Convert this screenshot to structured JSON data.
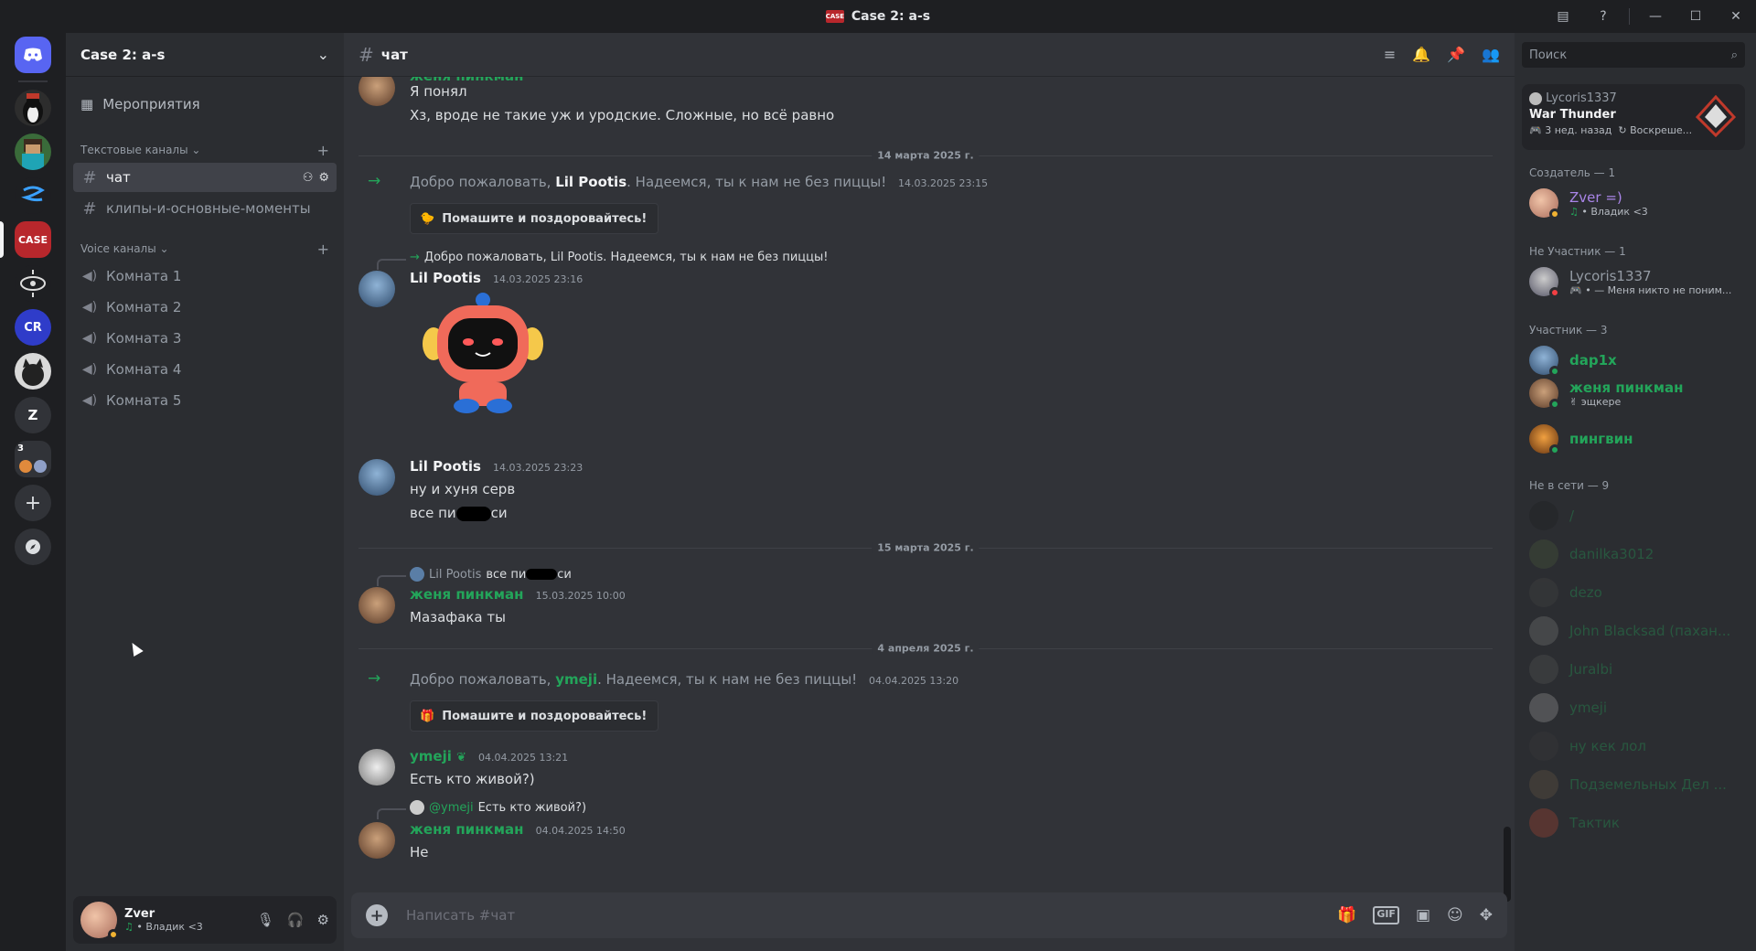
{
  "window": {
    "title": "Case 2: a-s"
  },
  "guilds": [
    {
      "name": "discord-home",
      "label": ""
    },
    {
      "name": "server-penguin",
      "label": ""
    },
    {
      "name": "server-minecraft",
      "label": ""
    },
    {
      "name": "server-blue-swirl",
      "label": ""
    },
    {
      "name": "server-case",
      "label": "CASE"
    },
    {
      "name": "server-eye",
      "label": ""
    },
    {
      "name": "server-cr",
      "label": "CR"
    },
    {
      "name": "server-cat",
      "label": ""
    },
    {
      "name": "server-z",
      "label": "Z"
    },
    {
      "name": "server-folder",
      "label": "3"
    },
    {
      "name": "add-server",
      "label": "+"
    },
    {
      "name": "discover",
      "label": ""
    }
  ],
  "sidebar": {
    "guild_name": "Case 2: a-s",
    "events_label": "Мероприятия",
    "text_category": "Текстовые каналы",
    "voice_category": "Voice каналы",
    "text_channels": [
      "чат",
      "клипы-и-основные-моменты"
    ],
    "voice_channels": [
      "Комната 1",
      "Комната 2",
      "Комната 3",
      "Комната 4",
      "Комната 5"
    ]
  },
  "user_panel": {
    "name": "Zver",
    "status": "• Владик <3"
  },
  "chat": {
    "channel": "чат",
    "placeholder": "Написать #чат",
    "top_partial_name": "женя пинкман",
    "top_lines": [
      "Я понял",
      "Хз, вроде не такие уж и уродские. Сложные, но всё равно"
    ],
    "divider1": "14 марта 2025 г.",
    "welcome1": {
      "pre": "Добро пожаловать, ",
      "user": "Lil Pootis",
      "post": ". Надеемся, ты к нам не без пиццы!",
      "time": "14.03.2025 23:15",
      "button": "Помашите и поздоровайтесь!"
    },
    "reply1": {
      "text": "Добро пожаловать, Lil Pootis. Надеемся, ты к нам не без пиццы!"
    },
    "msg1": {
      "author": "Lil Pootis",
      "time": "14.03.2025 23:16"
    },
    "msg2": {
      "author": "Lil Pootis",
      "time": "14.03.2025 23:23",
      "lines": [
        "ну и хуня серв",
        "все пи"
      ],
      "tail": "си"
    },
    "divider2": "15 марта 2025 г.",
    "reply2": {
      "author": "Lil Pootis",
      "text": "все пи",
      "tail": "си"
    },
    "msg3": {
      "author": "женя пинкман",
      "time": "15.03.2025 10:00",
      "text": "Мазафака ты"
    },
    "divider3": "4 апреля 2025 г.",
    "welcome2": {
      "pre": "Добро пожаловать, ",
      "user": "ymeji",
      "post": ". Надеемся, ты к нам не без пиццы!",
      "time": "04.04.2025 13:20",
      "button": "Помашите и поздоровайтесь!"
    },
    "msg4": {
      "author": "ymeji",
      "time": "04.04.2025 13:21",
      "text": "Есть кто живой?)"
    },
    "reply3": {
      "author": "@ymeji",
      "text": "Есть кто живой?)"
    },
    "msg5": {
      "author": "женя пинкман",
      "time": "04.04.2025 14:50",
      "text": "Не"
    }
  },
  "members": {
    "search_placeholder": "Поиск",
    "activity": {
      "user": "Lycoris1337",
      "game": "War Thunder",
      "ago": "3 нед. назад",
      "extra": "Воскреше..."
    },
    "groups": {
      "creator": "Создатель — 1",
      "non_member": "Не Участник — 1",
      "member": "Участник — 3",
      "offline": "Не в сети — 9"
    },
    "creator": {
      "name": "Zver =)",
      "sub": "• Владик <3"
    },
    "nonmember": {
      "name": "Lycoris1337",
      "sub": "• — Меня никто не поним..."
    },
    "members": [
      {
        "name": "dap1x",
        "sub": ""
      },
      {
        "name": "женя пинкман",
        "sub": "эщкере"
      },
      {
        "name": "пингвин",
        "sub": ""
      }
    ],
    "offline": [
      "/",
      "danilka3012",
      "dezo",
      "John Blacksad (пахан...",
      "Juralbi",
      "ymeji",
      "ну кек лол",
      "Подземельных Дел ...",
      "Тактик"
    ]
  },
  "colors": {
    "green_name": "#23a55a",
    "purple_name": "#a985e8",
    "accent": "#5865f2"
  }
}
